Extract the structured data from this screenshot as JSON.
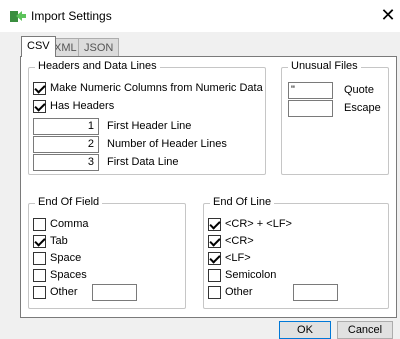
{
  "window": {
    "title": "Import Settings",
    "close_glyph": "✕"
  },
  "tabs": [
    {
      "label": "CSV",
      "active": true
    },
    {
      "label": "XML",
      "active": false
    },
    {
      "label": "JSON",
      "active": false
    }
  ],
  "headers_group": {
    "title": "Headers and Data Lines",
    "make_numeric": {
      "label": "Make Numeric Columns from Numeric Data",
      "checked": true
    },
    "has_headers": {
      "label": "Has Headers",
      "checked": true
    },
    "first_header_line": {
      "value": "1",
      "label": "First Header Line"
    },
    "num_header_lines": {
      "value": "2",
      "label": "Number of Header Lines"
    },
    "first_data_line": {
      "value": "3",
      "label": "First Data Line"
    }
  },
  "unusual_files": {
    "title": "Unusual Files",
    "quote": {
      "value": "\"",
      "label": "Quote"
    },
    "escape": {
      "value": "",
      "label": "Escape"
    }
  },
  "end_of_field": {
    "title": "End Of Field",
    "items": [
      {
        "label": "Comma",
        "checked": false
      },
      {
        "label": "Tab",
        "checked": true
      },
      {
        "label": "Space",
        "checked": false
      },
      {
        "label": "Spaces",
        "checked": false
      },
      {
        "label": "Other",
        "checked": false
      }
    ],
    "other_value": ""
  },
  "end_of_line": {
    "title": "End Of Line",
    "items": [
      {
        "label": "<CR> + <LF>",
        "checked": true
      },
      {
        "label": "<CR>",
        "checked": true
      },
      {
        "label": "<LF>",
        "checked": true
      },
      {
        "label": "Semicolon",
        "checked": false
      },
      {
        "label": "Other",
        "checked": false
      }
    ],
    "other_value": ""
  },
  "buttons": {
    "ok": "OK",
    "cancel": "Cancel"
  },
  "colors": {
    "icon_green": "#2e9e3a",
    "focus_blue": "#0078d7"
  }
}
